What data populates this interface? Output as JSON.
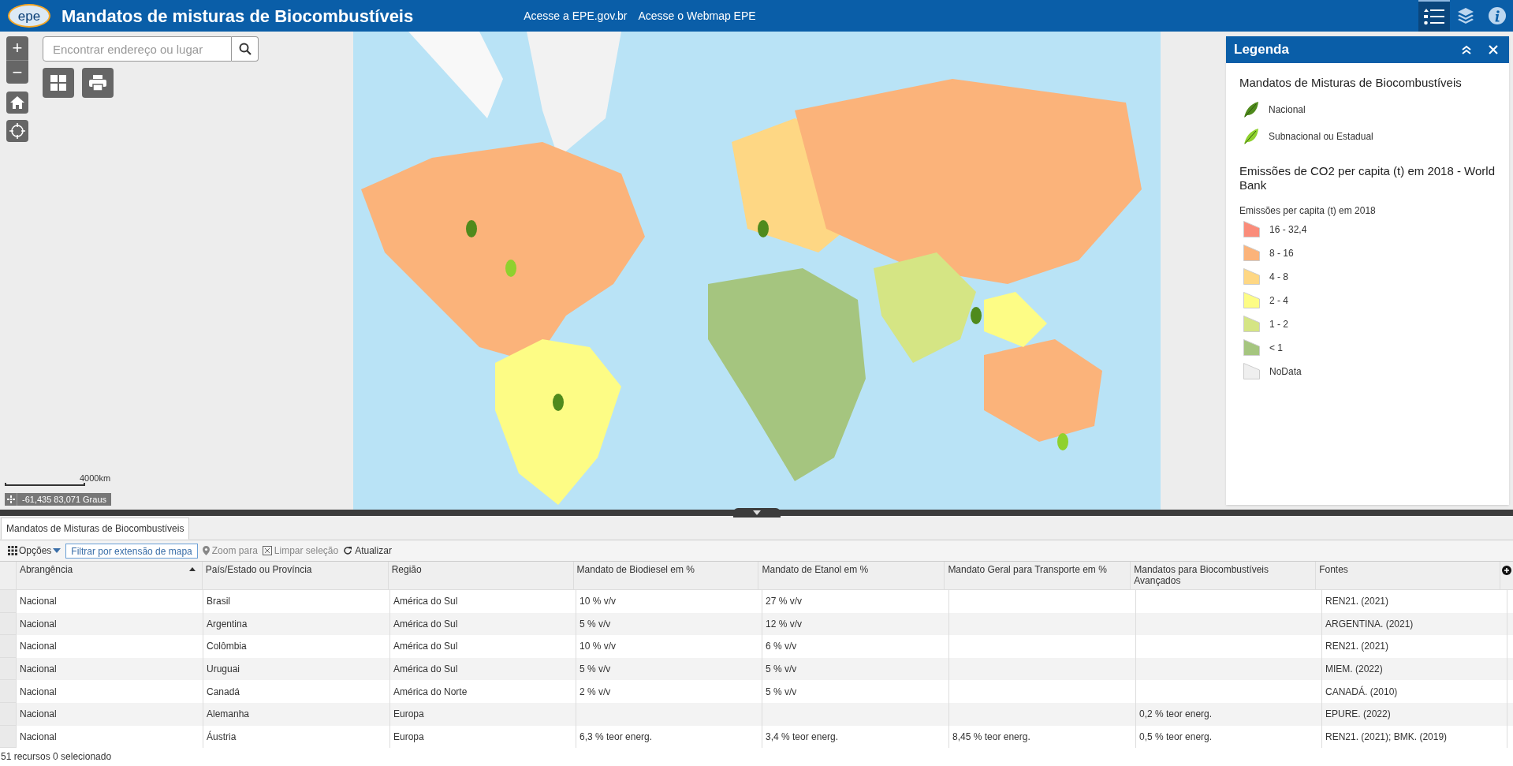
{
  "header": {
    "logo": "epe",
    "title": "Mandatos de misturas de Biocombustíveis",
    "links": [
      "Acesse a EPE.gov.br",
      "Acesse o Webmap EPE"
    ],
    "widgets": [
      {
        "kind": "legend",
        "selected": true
      },
      {
        "kind": "layers",
        "selected": false
      },
      {
        "kind": "info",
        "selected": false
      }
    ]
  },
  "map": {
    "zoom_in": "+",
    "zoom_out": "−",
    "search": {
      "placeholder": "Encontrar endereço ou lugar"
    },
    "scale": "4000km",
    "coordinates": "-61,435 83,071 Graus"
  },
  "legend": {
    "title": "Legenda",
    "layers": [
      {
        "title": "Mandatos de Misturas de Biocombustíveis",
        "items": [
          {
            "kind": "leaf",
            "label": "Nacional",
            "color": "#4f8a1c"
          },
          {
            "kind": "leaf",
            "label": "Subnacional ou Estadual",
            "color": "#8fd12e"
          }
        ]
      },
      {
        "title": "Emissões de CO2 per capita (t) em 2018 - World Bank",
        "subtitle": "Emissões per capita (t) em 2018",
        "items": [
          {
            "kind": "swatch",
            "label": "16 - 32,4",
            "color": "#fa8c7a"
          },
          {
            "kind": "swatch",
            "label": "8 - 16",
            "color": "#fbb37a"
          },
          {
            "kind": "swatch",
            "label": "4 - 8",
            "color": "#fed784"
          },
          {
            "kind": "swatch",
            "label": "2 - 4",
            "color": "#fdfc85"
          },
          {
            "kind": "swatch",
            "label": "1 - 2",
            "color": "#d5e584"
          },
          {
            "kind": "swatch",
            "label": "< 1",
            "color": "#a5c57f"
          },
          {
            "kind": "swatch",
            "label": "NoData",
            "color": "#efefef"
          }
        ]
      }
    ]
  },
  "attribute_table": {
    "tabs": [
      {
        "label": "Mandatos de Misturas de Biocombustíveis",
        "selected": true
      }
    ],
    "toolbar": {
      "options": "Opções",
      "filter": "Filtrar por extensão de mapa",
      "zoom": "Zoom para",
      "clear": "Limpar seleção",
      "refresh": "Atualizar"
    },
    "columns": [
      {
        "label": "Abrangência",
        "sorted": true
      },
      {
        "label": "País/Estado ou Província",
        "sorted": false
      },
      {
        "label": "Região",
        "sorted": false
      },
      {
        "label": "Mandato de Biodiesel em %",
        "sorted": false
      },
      {
        "label": "Mandato de Etanol em %",
        "sorted": false
      },
      {
        "label": "Mandato Geral para Transporte em %",
        "sorted": false
      },
      {
        "label": "Mandatos para Biocombustíveis Avançados",
        "sorted": false
      },
      {
        "label": "Fontes",
        "sorted": false
      }
    ],
    "rows": [
      [
        "Nacional",
        "Brasil",
        "América do Sul",
        "10 % v/v",
        "27 % v/v",
        "",
        "",
        "REN21. (2021)"
      ],
      [
        "Nacional",
        "Argentina",
        "América do Sul",
        "5 % v/v",
        "12 % v/v",
        "",
        "",
        "ARGENTINA. (2021)"
      ],
      [
        "Nacional",
        "Colômbia",
        "América do Sul",
        "10 % v/v",
        "6 % v/v",
        "",
        "",
        "REN21. (2021)"
      ],
      [
        "Nacional",
        "Uruguai",
        "América do Sul",
        "5 % v/v",
        "5 % v/v",
        "",
        "",
        "MIEM. (2022)"
      ],
      [
        "Nacional",
        "Canadá",
        "América do Norte",
        "2 % v/v",
        "5 % v/v",
        "",
        "",
        "CANADÁ. (2010)"
      ],
      [
        "Nacional",
        "Alemanha",
        "Europa",
        "",
        "",
        "",
        "0,2 % teor energ.",
        "EPURE. (2022)"
      ],
      [
        "Nacional",
        "Áustria",
        "Europa",
        "6,3 % teor energ.",
        "3,4 % teor energ.",
        "8,45 % teor energ.",
        "0,5 % teor energ.",
        "REN21. (2021); BMK. (2019)"
      ]
    ],
    "status": "51 recursos 0 selecionado"
  }
}
